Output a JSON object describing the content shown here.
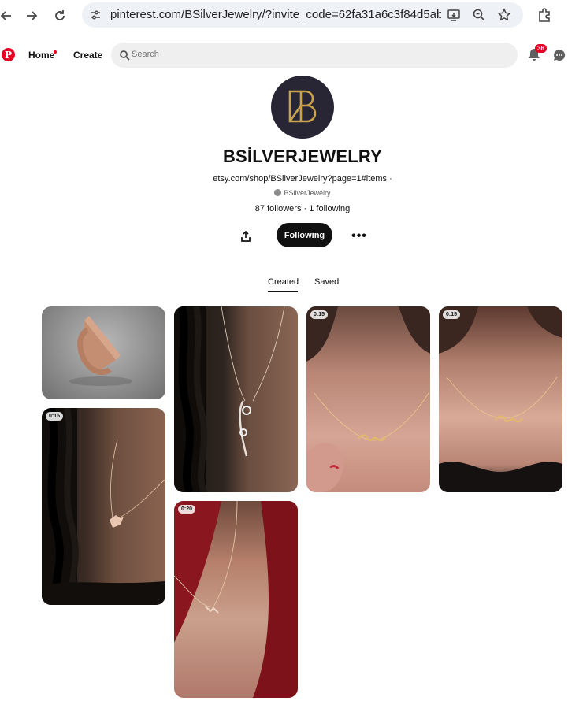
{
  "browser": {
    "url": "pinterest.com/BSilverJewelry/?invite_code=62fa31a6c3f84d5abbe..."
  },
  "header": {
    "logo": "P",
    "home_label": "Home",
    "create_label": "Create",
    "search_placeholder": "Search",
    "notification_count": "36"
  },
  "profile": {
    "avatar_monogram": "B",
    "name": "BSİLVERJEWELRY",
    "website": "etsy.com/shop/BSilverJewelry?page=1#items ·",
    "handle": "BSilverJewelry",
    "stats": "87 followers · 1 following",
    "follow_label": "Following",
    "more_label": "•••"
  },
  "tabs": [
    {
      "label": "Created",
      "active": true
    },
    {
      "label": "Saved",
      "active": false
    }
  ],
  "pins": [
    {
      "subject": "ring-a",
      "duration": ""
    },
    {
      "subject": "necklace-floral",
      "duration": ""
    },
    {
      "subject": "necklace-name-hand",
      "duration": "0:15"
    },
    {
      "subject": "necklace-name",
      "duration": "0:15"
    },
    {
      "subject": "necklace-dove",
      "duration": "0:15"
    },
    {
      "subject": "necklace-bird",
      "duration": "0:20"
    }
  ],
  "colors": {
    "brand_red": "#e60023",
    "button_black": "#111111",
    "avatar_bg": "#282634",
    "avatar_gold": "#c9a24a"
  }
}
